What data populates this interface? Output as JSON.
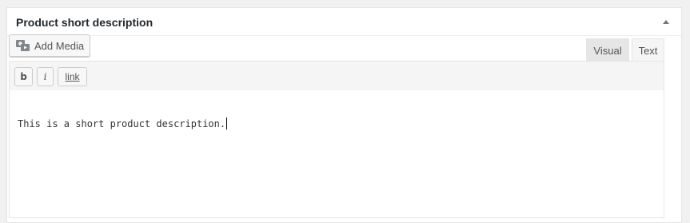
{
  "metabox": {
    "title": "Product short description"
  },
  "toolbar": {
    "add_media_label": "Add Media"
  },
  "tabs": {
    "visual": "Visual",
    "text": "Text",
    "active": "Text"
  },
  "quicktags": {
    "bold": "b",
    "italic": "i",
    "link": "link"
  },
  "editor": {
    "content": "This is a short product description."
  },
  "icons": {
    "add_media": "media-camera-icon",
    "toggle": "triangle-up-icon"
  }
}
